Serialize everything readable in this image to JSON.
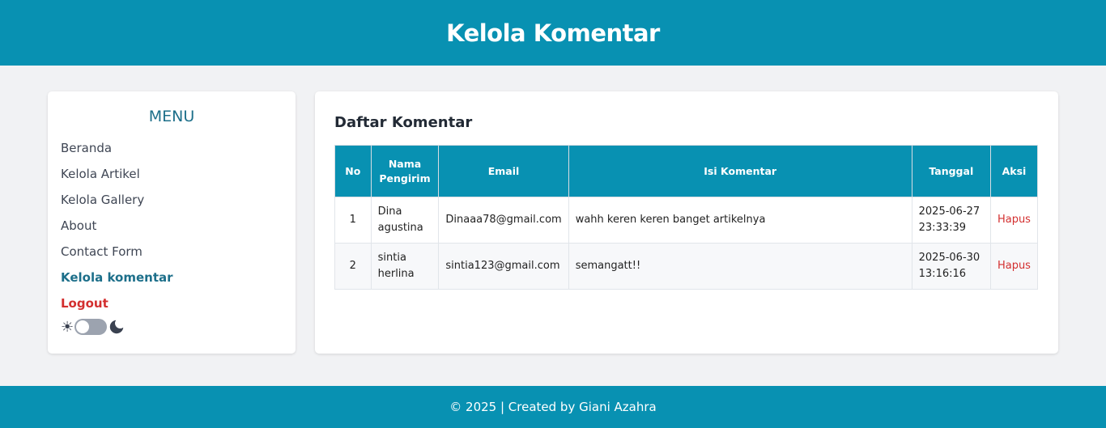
{
  "header": {
    "title": "Kelola Komentar"
  },
  "sidebar": {
    "title": "MENU",
    "items": [
      {
        "label": "Beranda"
      },
      {
        "label": "Kelola Artikel"
      },
      {
        "label": "Kelola Gallery"
      },
      {
        "label": "About"
      },
      {
        "label": "Contact Form"
      },
      {
        "label": "Kelola komentar"
      },
      {
        "label": "Logout"
      }
    ],
    "theme_toggle": {
      "state": "light",
      "icons": [
        "sun-icon",
        "moon-icon"
      ]
    }
  },
  "main": {
    "title": "Daftar Komentar",
    "table": {
      "headers": [
        "No",
        "Nama Pengirim",
        "Email",
        "Isi Komentar",
        "Tanggal",
        "Aksi"
      ],
      "rows": [
        {
          "no": "1",
          "nama": "Dina agustina",
          "email": "Dinaaa78@gmail.com",
          "isi": "wahh keren keren banget artikelnya",
          "tanggal": "2025-06-27 23:33:39",
          "aksi": "Hapus"
        },
        {
          "no": "2",
          "nama": "sintia herlina",
          "email": "sintia123@gmail.com",
          "isi": "semangatt!!",
          "tanggal": "2025-06-30 13:16:16",
          "aksi": "Hapus"
        }
      ]
    }
  },
  "footer": {
    "text": "© 2025 | Created by Giani Azahra"
  },
  "colors": {
    "primary": "#0891b2",
    "active": "#1d6f8a",
    "danger": "#d32f2f",
    "background": "#f1f2f4"
  }
}
